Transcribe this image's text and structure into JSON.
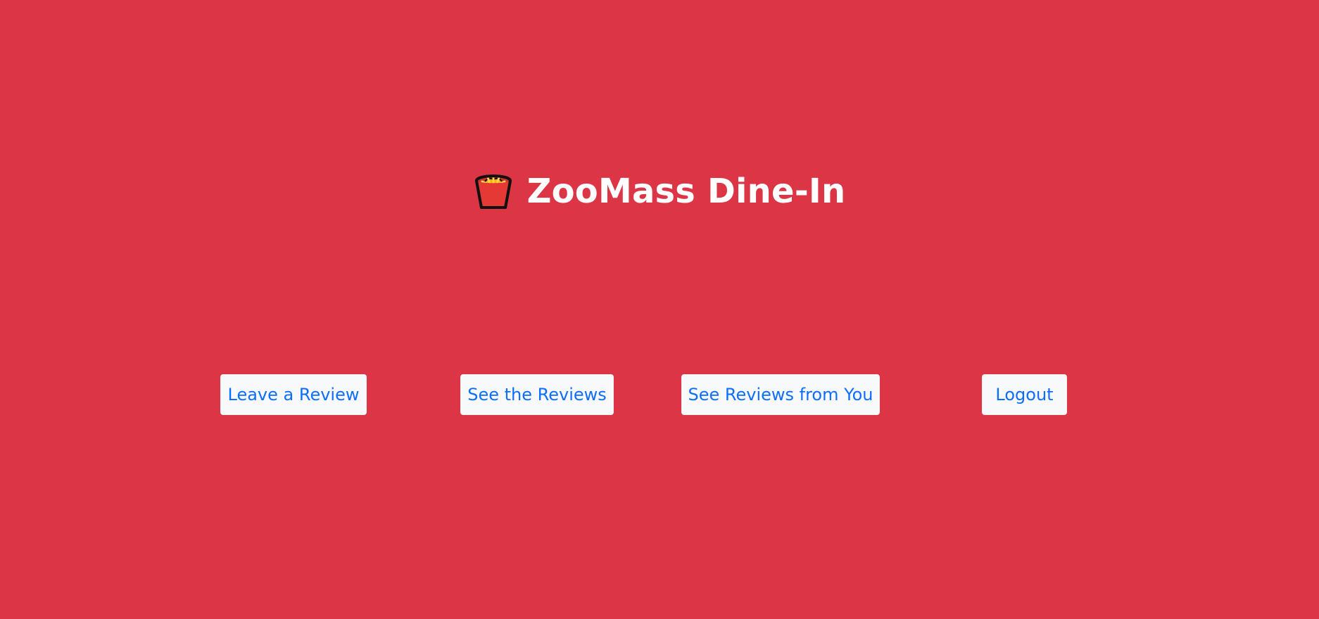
{
  "header": {
    "logo_icon": "french-fries-icon",
    "title": "ZooMass Dine-In"
  },
  "nav": {
    "leave_review": "Leave a Review",
    "see_reviews": "See the Reviews",
    "see_my_reviews": "See Reviews from You",
    "logout": "Logout"
  },
  "theme": {
    "background": "#dc3545",
    "button_bg": "#f8f9fa",
    "button_text": "#0d6efd",
    "title_text": "#ffffff"
  }
}
